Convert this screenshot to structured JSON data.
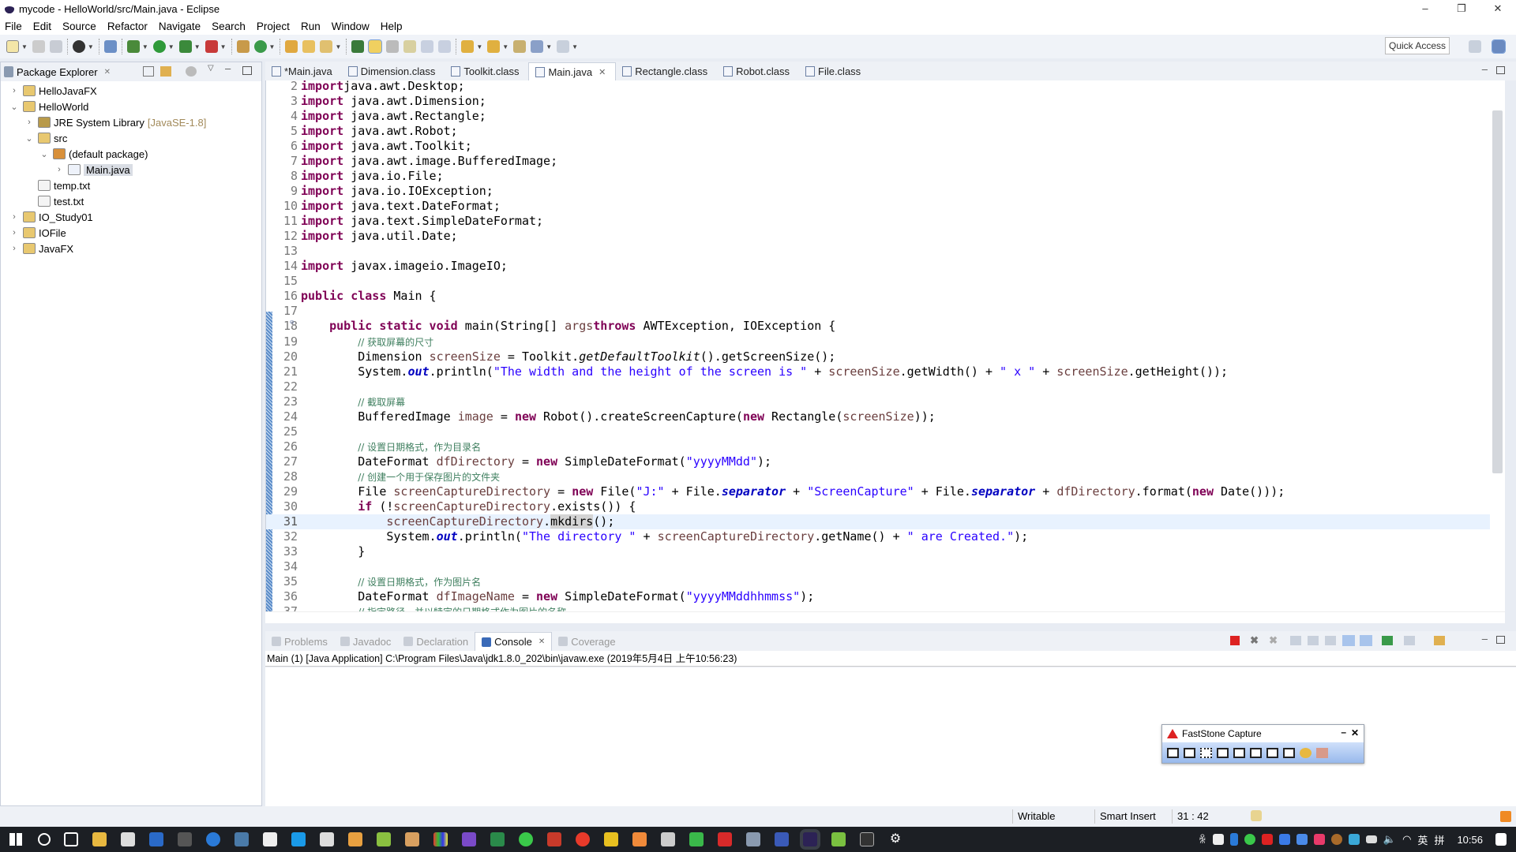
{
  "window": {
    "title": "mycode - HelloWorld/src/Main.java - Eclipse",
    "minimize": "–",
    "restore": "❐",
    "close": "✕"
  },
  "menu": [
    "File",
    "Edit",
    "Source",
    "Refactor",
    "Navigate",
    "Search",
    "Project",
    "Run",
    "Window",
    "Help"
  ],
  "toolbar": {
    "quick_access": "Quick Access"
  },
  "package_explorer": {
    "title": "Package Explorer",
    "close": "✕",
    "nodes": [
      {
        "label": "HelloJavaFX",
        "depth": 0,
        "twisty": "›",
        "icon": "project-icon"
      },
      {
        "label": "HelloWorld",
        "depth": 0,
        "twisty": "⌄",
        "icon": "project-icon"
      },
      {
        "label": "JRE System Library",
        "deco": "[JavaSE-1.8]",
        "depth": 1,
        "twisty": "›",
        "icon": "library-icon"
      },
      {
        "label": "src",
        "depth": 1,
        "twisty": "⌄",
        "icon": "source-folder-icon"
      },
      {
        "label": "(default package)",
        "depth": 2,
        "twisty": "⌄",
        "icon": "package-icon"
      },
      {
        "label": "Main.java",
        "depth": 3,
        "twisty": "›",
        "icon": "java-file-icon",
        "selected": true
      },
      {
        "label": "temp.txt",
        "depth": 1,
        "twisty": "",
        "icon": "text-file-icon"
      },
      {
        "label": "test.txt",
        "depth": 1,
        "twisty": "",
        "icon": "text-file-icon"
      },
      {
        "label": "IO_Study01",
        "depth": 0,
        "twisty": "›",
        "icon": "project-icon"
      },
      {
        "label": "IOFile",
        "depth": 0,
        "twisty": "›",
        "icon": "project-icon"
      },
      {
        "label": "JavaFX",
        "depth": 0,
        "twisty": "›",
        "icon": "project-icon"
      }
    ]
  },
  "editor": {
    "tabs": [
      {
        "label": "*Main.java"
      },
      {
        "label": "Dimension.class"
      },
      {
        "label": "Toolkit.class"
      },
      {
        "label": "Main.java",
        "active": true,
        "close": "✕"
      },
      {
        "label": "Rectangle.class"
      },
      {
        "label": "Robot.class"
      },
      {
        "label": "File.class"
      }
    ],
    "current_line": 31,
    "lines": [
      {
        "n": 2,
        "t": [
          [
            "k",
            "import"
          ],
          [
            "",
            "java.awt.Desktop;"
          ]
        ]
      },
      {
        "n": 3,
        "t": [
          [
            "k",
            "import"
          ],
          [
            "",
            " java.awt.Dimension;"
          ]
        ]
      },
      {
        "n": 4,
        "t": [
          [
            "k",
            "import"
          ],
          [
            "",
            " java.awt.Rectangle;"
          ]
        ]
      },
      {
        "n": 5,
        "t": [
          [
            "k",
            "import"
          ],
          [
            "",
            " java.awt.Robot;"
          ]
        ]
      },
      {
        "n": 6,
        "t": [
          [
            "k",
            "import"
          ],
          [
            "",
            " java.awt.Toolkit;"
          ]
        ]
      },
      {
        "n": 7,
        "t": [
          [
            "k",
            "import"
          ],
          [
            "",
            " java.awt.image.BufferedImage;"
          ]
        ]
      },
      {
        "n": 8,
        "t": [
          [
            "k",
            "import"
          ],
          [
            "",
            " java.io.File;"
          ]
        ]
      },
      {
        "n": 9,
        "t": [
          [
            "k",
            "import"
          ],
          [
            "",
            " java.io.IOException;"
          ]
        ]
      },
      {
        "n": 10,
        "t": [
          [
            "k",
            "import"
          ],
          [
            "",
            " java.text.DateFormat;"
          ]
        ]
      },
      {
        "n": 11,
        "t": [
          [
            "k",
            "import"
          ],
          [
            "",
            " java.text.SimpleDateFormat;"
          ]
        ]
      },
      {
        "n": 12,
        "t": [
          [
            "k",
            "import"
          ],
          [
            "",
            " java.util.Date;"
          ]
        ]
      },
      {
        "n": 13,
        "t": []
      },
      {
        "n": 14,
        "t": [
          [
            "k",
            "import"
          ],
          [
            "",
            " javax.imageio.ImageIO;"
          ]
        ]
      },
      {
        "n": 15,
        "t": []
      },
      {
        "n": 16,
        "t": [
          [
            "k",
            "public class"
          ],
          [
            "",
            " Main {"
          ]
        ]
      },
      {
        "n": 17,
        "t": []
      },
      {
        "n": 18,
        "t": [
          [
            "",
            "    "
          ],
          [
            "k",
            "public static void"
          ],
          [
            "",
            " main(String[] "
          ],
          [
            "v",
            "args"
          ],
          [
            ") "
          ],
          [
            "k",
            "throws"
          ],
          [
            "",
            " AWTException, IOException {"
          ]
        ]
      },
      {
        "n": 19,
        "t": [
          [
            "",
            "        "
          ],
          [
            "c",
            "// 获取屏幕的尺寸"
          ]
        ]
      },
      {
        "n": 20,
        "t": [
          [
            "",
            "        Dimension "
          ],
          [
            "v",
            "screenSize"
          ],
          [
            "",
            " = Toolkit."
          ],
          [
            "m",
            "getDefaultToolkit"
          ],
          [
            "",
            "().getScreenSize();"
          ]
        ]
      },
      {
        "n": 21,
        "t": [
          [
            "",
            "        System."
          ],
          [
            "f",
            "out"
          ],
          [
            "",
            ".println("
          ],
          [
            "s",
            "\"The width and the height of the screen is \""
          ],
          [
            "",
            " + "
          ],
          [
            "v",
            "screenSize"
          ],
          [
            "",
            ".getWidth() + "
          ],
          [
            "s",
            "\" x \""
          ],
          [
            "",
            " + "
          ],
          [
            "v",
            "screenSize"
          ],
          [
            "",
            ".getHeight());"
          ]
        ]
      },
      {
        "n": 22,
        "t": []
      },
      {
        "n": 23,
        "t": [
          [
            "",
            "        "
          ],
          [
            "c",
            "// 截取屏幕"
          ]
        ]
      },
      {
        "n": 24,
        "t": [
          [
            "",
            "        BufferedImage "
          ],
          [
            "v",
            "image"
          ],
          [
            "",
            " = "
          ],
          [
            "k",
            "new"
          ],
          [
            "",
            " Robot().createScreenCapture("
          ],
          [
            "k",
            "new"
          ],
          [
            "",
            " Rectangle("
          ],
          [
            "v",
            "screenSize"
          ],
          [
            "",
            "));"
          ]
        ]
      },
      {
        "n": 25,
        "t": []
      },
      {
        "n": 26,
        "t": [
          [
            "",
            "        "
          ],
          [
            "c",
            "// 设置日期格式，作为目录名"
          ]
        ]
      },
      {
        "n": 27,
        "t": [
          [
            "",
            "        DateFormat "
          ],
          [
            "v",
            "dfDirectory"
          ],
          [
            "",
            " = "
          ],
          [
            "k",
            "new"
          ],
          [
            "",
            " SimpleDateFormat("
          ],
          [
            "s",
            "\"yyyyMMdd\""
          ],
          [
            "",
            ");"
          ]
        ]
      },
      {
        "n": 28,
        "t": [
          [
            "",
            "        "
          ],
          [
            "c",
            "// 创建一个用于保存图片的文件夹"
          ]
        ]
      },
      {
        "n": 29,
        "t": [
          [
            "",
            "        File "
          ],
          [
            "v",
            "screenCaptureDirectory"
          ],
          [
            "",
            " = "
          ],
          [
            "k",
            "new"
          ],
          [
            "",
            " File("
          ],
          [
            "s",
            "\"J:\""
          ],
          [
            "",
            " + File."
          ],
          [
            "f",
            "separator"
          ],
          [
            "",
            " + "
          ],
          [
            "s",
            "\"ScreenCapture\""
          ],
          [
            "",
            " + File."
          ],
          [
            "f",
            "separator"
          ],
          [
            "",
            " + "
          ],
          [
            "v",
            "dfDirectory"
          ],
          [
            "",
            ".format("
          ],
          [
            "k",
            "new"
          ],
          [
            "",
            " Date()));"
          ]
        ]
      },
      {
        "n": 30,
        "t": [
          [
            "",
            "        "
          ],
          [
            "k",
            "if"
          ],
          [
            "",
            " (!"
          ],
          [
            "v",
            "screenCaptureDirectory"
          ],
          [
            "",
            ".exists()) {"
          ]
        ]
      },
      {
        "n": 31,
        "t": [
          [
            "",
            "            "
          ],
          [
            "v",
            "screenCaptureDirectory"
          ],
          [
            "",
            "."
          ],
          [
            "h",
            "mkdirs"
          ],
          [
            "",
            "();"
          ]
        ]
      },
      {
        "n": 32,
        "t": [
          [
            "",
            "            System."
          ],
          [
            "f",
            "out"
          ],
          [
            "",
            ".println("
          ],
          [
            "s",
            "\"The directory \""
          ],
          [
            "",
            " + "
          ],
          [
            "v",
            "screenCaptureDirectory"
          ],
          [
            "",
            ".getName() + "
          ],
          [
            "s",
            "\" are Created.\""
          ],
          [
            "",
            ");"
          ]
        ]
      },
      {
        "n": 33,
        "t": [
          [
            "",
            "        }"
          ]
        ]
      },
      {
        "n": 34,
        "t": []
      },
      {
        "n": 35,
        "t": [
          [
            "",
            "        "
          ],
          [
            "c",
            "// 设置日期格式，作为图片名"
          ]
        ]
      },
      {
        "n": 36,
        "t": [
          [
            "",
            "        DateFormat "
          ],
          [
            "v",
            "dfImageName"
          ],
          [
            "",
            " = "
          ],
          [
            "k",
            "new"
          ],
          [
            "",
            " SimpleDateFormat("
          ],
          [
            "s",
            "\"yyyyMMddhhmmss\""
          ],
          [
            "",
            ");"
          ]
        ]
      },
      {
        "n": 37,
        "t": [
          [
            "",
            "        "
          ],
          [
            "c",
            "// 指定路径，并以特定的日期格式作为图片的名称"
          ]
        ]
      }
    ]
  },
  "console": {
    "tabs": [
      {
        "label": "Problems"
      },
      {
        "label": "Javadoc"
      },
      {
        "label": "Declaration"
      },
      {
        "label": "Console",
        "active": true,
        "close": "✕"
      },
      {
        "label": "Coverage"
      }
    ],
    "header": "Main (1) [Java Application] C:\\Program Files\\Java\\jdk1.8.0_202\\bin\\javaw.exe (2019年5月4日 上午10:56:23)"
  },
  "status": {
    "writable": "Writable",
    "insert_mode": "Smart Insert",
    "position": "31 : 42"
  },
  "faststone": {
    "title": "FastStone Capture",
    "minimize": "–",
    "close": "✕"
  },
  "taskbar": {
    "clock": "10:56",
    "ime1": "英",
    "ime2": "拼"
  },
  "colors": {
    "keyword": "#7f0055",
    "string": "#2a00ff",
    "comment": "#3f7f5f",
    "field": "#0000c0",
    "local": "#6a3e3e",
    "taskbar": "#1c1f24"
  }
}
